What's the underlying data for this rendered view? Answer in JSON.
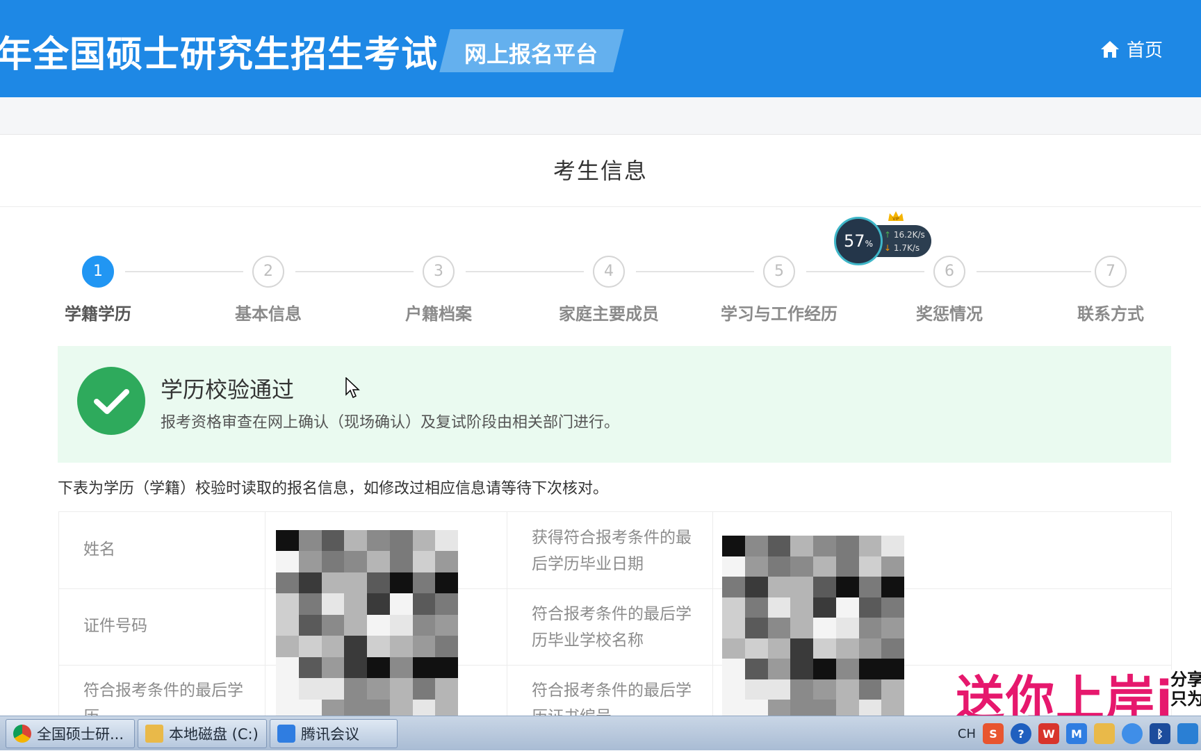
{
  "header": {
    "title": "年全国硕士研究生招生考试",
    "badge": "网上报名平台",
    "home_label": "首页"
  },
  "section": {
    "title": "考生信息"
  },
  "steps": [
    {
      "number": "1",
      "label": "学籍学历",
      "active": true
    },
    {
      "number": "2",
      "label": "基本信息",
      "active": false
    },
    {
      "number": "3",
      "label": "户籍档案",
      "active": false
    },
    {
      "number": "4",
      "label": "家庭主要成员",
      "active": false
    },
    {
      "number": "5",
      "label": "学习与工作经历",
      "active": false
    },
    {
      "number": "6",
      "label": "奖惩情况",
      "active": false
    },
    {
      "number": "7",
      "label": "联系方式",
      "active": false
    }
  ],
  "speed_widget": {
    "percent": "57",
    "percent_unit": "%",
    "upload": "16.2K/s",
    "download": "1.7K/s",
    "badge": "VIP"
  },
  "alert": {
    "title": "学历校验通过",
    "description": "报考资格审查在网上确认（现场确认）及复试阶段由相关部门进行。"
  },
  "note": "下表为学历（学籍）校验时读取的报名信息，如修改过相应信息请等待下次核对。",
  "info_table": {
    "left_labels": [
      "姓名",
      "证件号码",
      "符合报考条件的最后学历"
    ],
    "right_labels": [
      "获得符合报考条件的最后学历毕业日期",
      "符合报考条件的最后学历毕业学校名称",
      "符合报考条件的最后学历证书编号"
    ]
  },
  "watermark": {
    "main": "送你上岸i",
    "side_line1": "分享",
    "side_line2": "只为"
  },
  "taskbar": {
    "items": [
      {
        "label": "全国硕士研...",
        "icon": "chrome-icon"
      },
      {
        "label": "本地磁盘 (C:)",
        "icon": "folder-icon"
      },
      {
        "label": "腾讯会议",
        "icon": "tencent-meeting-icon"
      }
    ],
    "tray_lang": "CH"
  },
  "colors": {
    "header_blue": "#1e88e5",
    "active_step": "#2196f3",
    "success_green": "#2eaa5c",
    "alert_bg": "#eafaf0",
    "watermark_pink": "#e6186d"
  }
}
